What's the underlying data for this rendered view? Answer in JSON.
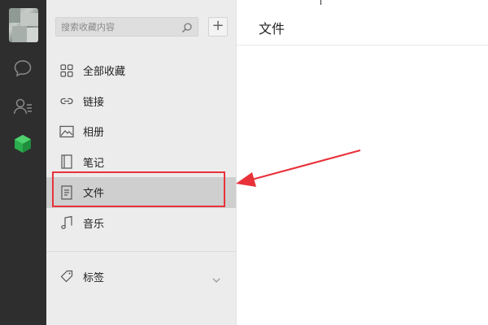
{
  "rail": {
    "icons": [
      "chat-icon",
      "contacts-icon",
      "favorites-cube-icon"
    ],
    "accent": "#2bae4e"
  },
  "search": {
    "placeholder": "搜索收藏内容",
    "value": ""
  },
  "add_label": "+",
  "menu": {
    "items": [
      {
        "label": "全部收藏",
        "icon": "grid-icon",
        "active": false
      },
      {
        "label": "链接",
        "icon": "link-icon",
        "active": false
      },
      {
        "label": "相册",
        "icon": "image-icon",
        "active": false
      },
      {
        "label": "笔记",
        "icon": "notebook-icon",
        "active": false
      },
      {
        "label": "文件",
        "icon": "file-icon",
        "active": true
      },
      {
        "label": "音乐",
        "icon": "music-icon",
        "active": false
      }
    ]
  },
  "tags": {
    "label": "标签",
    "icon": "tag-icon"
  },
  "content": {
    "title": "文件"
  },
  "annotation": {
    "color": "#e8323a"
  }
}
